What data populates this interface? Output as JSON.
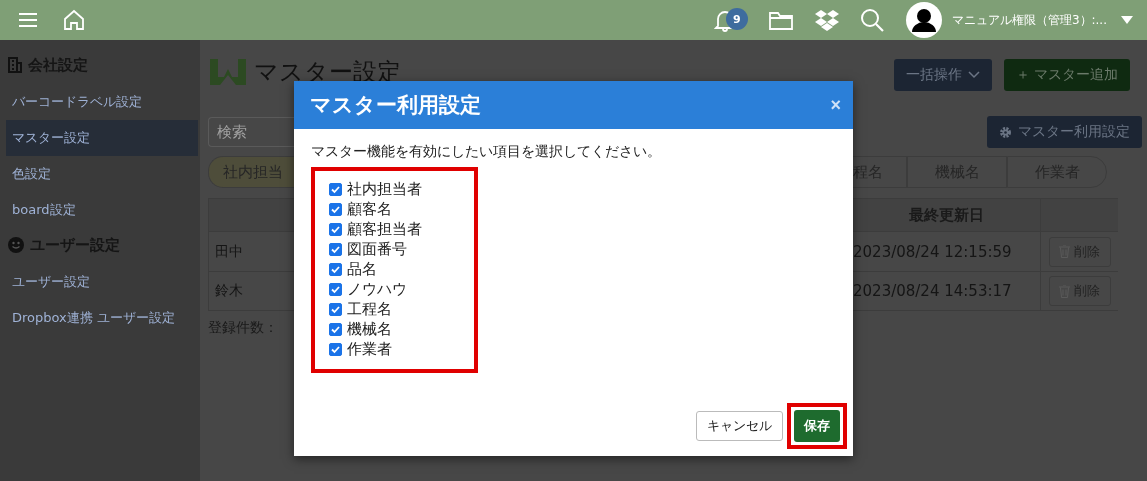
{
  "topbar": {
    "notification_count": "9",
    "user_name": "マニュアル権限（管理3）:..."
  },
  "sidebar": {
    "sections": [
      {
        "title": "会社設定",
        "items": [
          {
            "label": "バーコードラベル設定",
            "selected": false
          },
          {
            "label": "マスター設定",
            "selected": true
          },
          {
            "label": "色設定",
            "selected": false
          },
          {
            "label": "board設定",
            "selected": false
          }
        ]
      },
      {
        "title": "ユーザー設定",
        "items": [
          {
            "label": "ユーザー設定",
            "selected": false
          },
          {
            "label": "Dropbox連携 ユーザー設定",
            "selected": false
          }
        ]
      }
    ]
  },
  "page": {
    "title": "マスター設定",
    "bulk_button": "一括操作",
    "add_button": "＋ マスター追加",
    "search": {
      "placeholder": "検索"
    },
    "usage_button": "マスター利用設定",
    "filter_chips": [
      {
        "label": "社内担当",
        "selected": true
      },
      {
        "label": "程名",
        "selected": false
      },
      {
        "label": "機械名",
        "selected": false
      },
      {
        "label": "作業者",
        "selected": false
      }
    ],
    "table": {
      "columns": [
        "最終更新日"
      ],
      "rows": [
        {
          "name": "田中",
          "updated": "2023/08/24 12:15:59",
          "action": "削除"
        },
        {
          "name": "鈴木",
          "updated": "2023/08/24 14:53:17",
          "action": "削除"
        }
      ]
    },
    "count_label": "登録件数："
  },
  "dialog": {
    "title": "マスター利用設定",
    "close": "×",
    "instruction": "マスター機能を有効にしたい項目を選択してください。",
    "items": [
      {
        "label": "社内担当者",
        "checked": true
      },
      {
        "label": "顧客名",
        "checked": true
      },
      {
        "label": "顧客担当者",
        "checked": true
      },
      {
        "label": "図面番号",
        "checked": true
      },
      {
        "label": "品名",
        "checked": true
      },
      {
        "label": "ノウハウ",
        "checked": true
      },
      {
        "label": "工程名",
        "checked": true
      },
      {
        "label": "機械名",
        "checked": true
      },
      {
        "label": "作業者",
        "checked": true
      }
    ],
    "cancel_button": "キャンセル",
    "save_button": "保存"
  }
}
